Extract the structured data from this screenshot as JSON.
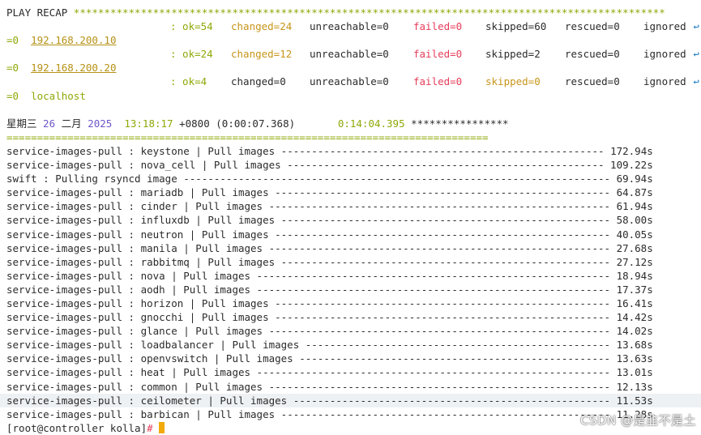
{
  "recap": {
    "header": "PLAY RECAP",
    "stars": "*************************************************************************************************",
    "wrap_glyph": "↩",
    "hosts": [
      {
        "name": "192.168.200.10",
        "ok": ": ok=54",
        "changed": "changed=24",
        "unreachable": "unreachable=0",
        "failed": "failed=0",
        "skipped": "skipped=60",
        "rescued": "rescued=0",
        "ignored": "ignored",
        "wrap": "=0"
      },
      {
        "name": "192.168.200.20",
        "ok": ": ok=24",
        "changed": "changed=12",
        "unreachable": "unreachable=0",
        "failed": "failed=0",
        "skipped": "skipped=2",
        "rescued": "rescued=0",
        "ignored": "ignored",
        "wrap": "=0"
      },
      {
        "name": "localhost",
        "ok": ": ok=4",
        "changed": "changed=0",
        "unreachable": "unreachable=0",
        "failed": "failed=0",
        "skipped": "skipped=0",
        "rescued": "rescued=0",
        "ignored": "ignored",
        "wrap": "=0"
      }
    ]
  },
  "timing": {
    "weekday": "星期三",
    "day": "26",
    "month": "二月",
    "year": "2025",
    "time": "13:18:17",
    "tz": "+0800",
    "elapsed": "(0:00:07.368)",
    "total": "0:14:04.395",
    "stars": "****************",
    "rule": "==============================================================================="
  },
  "tasks": [
    {
      "name": "service-images-pull : keystone | Pull images",
      "time": "172.94s"
    },
    {
      "name": "service-images-pull : nova_cell | Pull images",
      "time": "109.22s"
    },
    {
      "name": "swift : Pulling rsyncd image",
      "time": "69.94s"
    },
    {
      "name": "service-images-pull : mariadb | Pull images",
      "time": "64.87s"
    },
    {
      "name": "service-images-pull : cinder | Pull images",
      "time": "61.94s"
    },
    {
      "name": "service-images-pull : influxdb | Pull images",
      "time": "58.00s"
    },
    {
      "name": "service-images-pull : neutron | Pull images",
      "time": "40.05s"
    },
    {
      "name": "service-images-pull : manila | Pull images",
      "time": "27.68s"
    },
    {
      "name": "service-images-pull : rabbitmq | Pull images",
      "time": "27.12s"
    },
    {
      "name": "service-images-pull : nova | Pull images",
      "time": "18.94s"
    },
    {
      "name": "service-images-pull : aodh | Pull images",
      "time": "17.37s"
    },
    {
      "name": "service-images-pull : horizon | Pull images",
      "time": "16.41s"
    },
    {
      "name": "service-images-pull : gnocchi | Pull images",
      "time": "14.42s"
    },
    {
      "name": "service-images-pull : glance | Pull images",
      "time": "14.02s"
    },
    {
      "name": "service-images-pull : loadbalancer | Pull images",
      "time": "13.68s"
    },
    {
      "name": "service-images-pull : openvswitch | Pull images",
      "time": "13.63s"
    },
    {
      "name": "service-images-pull : heat | Pull images",
      "time": "13.01s"
    },
    {
      "name": "service-images-pull : common | Pull images",
      "time": "12.13s"
    },
    {
      "name": "service-images-pull : ceilometer | Pull images",
      "time": "11.53s"
    },
    {
      "name": "service-images-pull : barbican | Pull images",
      "time": "11.28s"
    }
  ],
  "prompt": {
    "text": "[root@controller kolla]",
    "symbol": "#"
  },
  "watermark": "CSDN @是韭不是土"
}
